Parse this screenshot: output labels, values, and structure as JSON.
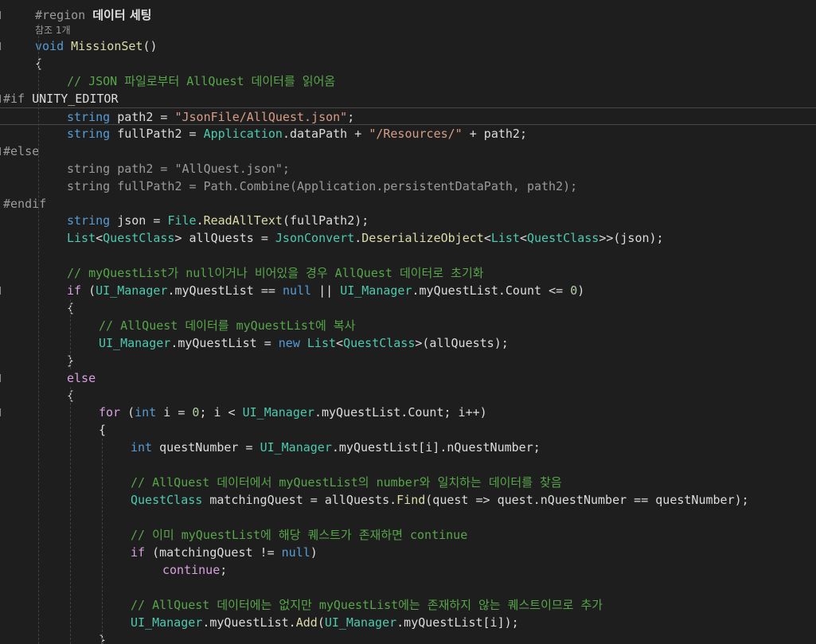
{
  "editor": {
    "colors": {
      "background": "#1e1e1e",
      "plain": "#dcdcdc",
      "keyword": "#569cd6",
      "control": "#d8a0df",
      "type": "#4ec9b0",
      "string": "#d69d85",
      "comment": "#57a64a",
      "number": "#b5cea8",
      "preprocessor": "#9b9b9b",
      "inactive": "#9b9b9b",
      "method": "#dcdcaa"
    },
    "lines": [
      {
        "tokens": [
          {
            "t": "#region ",
            "c": "pre"
          },
          {
            "t": "데이터 세팅",
            "c": "region"
          }
        ]
      },
      {
        "codelens": true,
        "tokens": [
          {
            "t": "참조 1개",
            "c": "lens"
          }
        ]
      },
      {
        "tokens": [
          {
            "t": "void ",
            "c": "kw"
          },
          {
            "t": "MissionSet",
            "c": "meth"
          },
          {
            "t": "()",
            "c": "plain"
          }
        ]
      },
      {
        "tokens": [
          {
            "t": "{",
            "c": "plain"
          }
        ]
      },
      {
        "tokens": [
          {
            "t": "// JSON 파일로부터 AllQuest 데이터를 읽어옴",
            "c": "com"
          }
        ]
      },
      {
        "tokens": [
          {
            "t": "#if ",
            "c": "pre"
          },
          {
            "t": "UNITY_EDITOR",
            "c": "plain"
          }
        ]
      },
      {
        "current": true,
        "tokens": [
          {
            "t": "string ",
            "c": "kw"
          },
          {
            "t": "path2 = ",
            "c": "plain"
          },
          {
            "t": "\"JsonFile/AllQuest.json\"",
            "c": "str"
          },
          {
            "t": ";",
            "c": "plain"
          }
        ]
      },
      {
        "tokens": [
          {
            "t": "string ",
            "c": "kw"
          },
          {
            "t": "fullPath2 = ",
            "c": "plain"
          },
          {
            "t": "Application",
            "c": "type"
          },
          {
            "t": ".dataPath + ",
            "c": "plain"
          },
          {
            "t": "\"/Resources/\"",
            "c": "str"
          },
          {
            "t": " + path2;",
            "c": "plain"
          }
        ]
      },
      {
        "tokens": [
          {
            "t": "#else",
            "c": "pre"
          }
        ]
      },
      {
        "tokens": [
          {
            "t": "string path2 = \"AllQuest.json\";",
            "c": "inact"
          }
        ]
      },
      {
        "tokens": [
          {
            "t": "string fullPath2 = Path.Combine(Application.persistentDataPath, path2);",
            "c": "inact"
          }
        ]
      },
      {
        "tokens": [
          {
            "t": "#endif",
            "c": "pre"
          }
        ]
      },
      {
        "tokens": [
          {
            "t": "string ",
            "c": "kw"
          },
          {
            "t": "json = ",
            "c": "plain"
          },
          {
            "t": "File",
            "c": "type"
          },
          {
            "t": ".",
            "c": "plain"
          },
          {
            "t": "ReadAllText",
            "c": "meth"
          },
          {
            "t": "(fullPath2);",
            "c": "plain"
          }
        ]
      },
      {
        "tokens": [
          {
            "t": "List",
            "c": "type"
          },
          {
            "t": "<",
            "c": "plain"
          },
          {
            "t": "QuestClass",
            "c": "type"
          },
          {
            "t": "> allQuests = ",
            "c": "plain"
          },
          {
            "t": "JsonConvert",
            "c": "type"
          },
          {
            "t": ".",
            "c": "plain"
          },
          {
            "t": "DeserializeObject",
            "c": "meth"
          },
          {
            "t": "<",
            "c": "plain"
          },
          {
            "t": "List",
            "c": "type"
          },
          {
            "t": "<",
            "c": "plain"
          },
          {
            "t": "QuestClass",
            "c": "type"
          },
          {
            "t": ">>(json);",
            "c": "plain"
          }
        ]
      },
      {
        "tokens": []
      },
      {
        "tokens": [
          {
            "t": "// myQuestList가 null이거나 비어있을 경우 AllQuest 데이터로 초기화",
            "c": "com"
          }
        ]
      },
      {
        "tokens": [
          {
            "t": "if",
            "c": "ctl"
          },
          {
            "t": " (",
            "c": "plain"
          },
          {
            "t": "UI_Manager",
            "c": "type"
          },
          {
            "t": ".myQuestList == ",
            "c": "plain"
          },
          {
            "t": "null",
            "c": "kw"
          },
          {
            "t": " || ",
            "c": "plain"
          },
          {
            "t": "UI_Manager",
            "c": "type"
          },
          {
            "t": ".myQuestList.Count <= ",
            "c": "plain"
          },
          {
            "t": "0",
            "c": "num"
          },
          {
            "t": ")",
            "c": "plain"
          }
        ]
      },
      {
        "tokens": [
          {
            "t": "{",
            "c": "plain"
          }
        ]
      },
      {
        "tokens": [
          {
            "t": "// AllQuest 데이터를 myQuestList에 복사",
            "c": "com"
          }
        ]
      },
      {
        "tokens": [
          {
            "t": "UI_Manager",
            "c": "type"
          },
          {
            "t": ".myQuestList = ",
            "c": "plain"
          },
          {
            "t": "new ",
            "c": "kw"
          },
          {
            "t": "List",
            "c": "type"
          },
          {
            "t": "<",
            "c": "plain"
          },
          {
            "t": "QuestClass",
            "c": "type"
          },
          {
            "t": ">(allQuests);",
            "c": "plain"
          }
        ]
      },
      {
        "tokens": [
          {
            "t": "}",
            "c": "plain"
          }
        ]
      },
      {
        "tokens": [
          {
            "t": "else",
            "c": "ctl"
          }
        ]
      },
      {
        "tokens": [
          {
            "t": "{",
            "c": "plain"
          }
        ]
      },
      {
        "tokens": [
          {
            "t": "for",
            "c": "ctl"
          },
          {
            "t": " (",
            "c": "plain"
          },
          {
            "t": "int ",
            "c": "kw"
          },
          {
            "t": "i = ",
            "c": "plain"
          },
          {
            "t": "0",
            "c": "num"
          },
          {
            "t": "; i < ",
            "c": "plain"
          },
          {
            "t": "UI_Manager",
            "c": "type"
          },
          {
            "t": ".myQuestList.Count; i++)",
            "c": "plain"
          }
        ]
      },
      {
        "tokens": [
          {
            "t": "{",
            "c": "plain"
          }
        ]
      },
      {
        "tokens": [
          {
            "t": "int ",
            "c": "kw"
          },
          {
            "t": "questNumber = ",
            "c": "plain"
          },
          {
            "t": "UI_Manager",
            "c": "type"
          },
          {
            "t": ".myQuestList[i].nQuestNumber;",
            "c": "plain"
          }
        ]
      },
      {
        "tokens": []
      },
      {
        "tokens": [
          {
            "t": "// AllQuest 데이터에서 myQuestList의 number와 일치하는 데이터를 찾음",
            "c": "com"
          }
        ]
      },
      {
        "tokens": [
          {
            "t": "QuestClass",
            "c": "type"
          },
          {
            "t": " matchingQuest = allQuests.",
            "c": "plain"
          },
          {
            "t": "Find",
            "c": "meth"
          },
          {
            "t": "(quest => quest.nQuestNumber == questNumber);",
            "c": "plain"
          }
        ]
      },
      {
        "tokens": []
      },
      {
        "tokens": [
          {
            "t": "// 이미 myQuestList에 해당 퀘스트가 존재하면 continue",
            "c": "com"
          }
        ]
      },
      {
        "tokens": [
          {
            "t": "if",
            "c": "ctl"
          },
          {
            "t": " (matchingQuest != ",
            "c": "plain"
          },
          {
            "t": "null",
            "c": "kw"
          },
          {
            "t": ")",
            "c": "plain"
          }
        ]
      },
      {
        "tokens": [
          {
            "t": "continue",
            "c": "ctl"
          },
          {
            "t": ";",
            "c": "plain"
          }
        ]
      },
      {
        "tokens": []
      },
      {
        "tokens": [
          {
            "t": "// AllQuest 데이터에는 없지만 myQuestList에는 존재하지 않는 퀘스트이므로 추가",
            "c": "com"
          }
        ]
      },
      {
        "tokens": [
          {
            "t": "UI_Manager",
            "c": "type"
          },
          {
            "t": ".myQuestList.",
            "c": "plain"
          },
          {
            "t": "Add",
            "c": "meth"
          },
          {
            "t": "(",
            "c": "plain"
          },
          {
            "t": "UI_Manager",
            "c": "type"
          },
          {
            "t": ".myQuestList[i]);",
            "c": "plain"
          }
        ]
      },
      {
        "tokens": [
          {
            "t": "}",
            "c": "plain"
          }
        ]
      }
    ]
  }
}
